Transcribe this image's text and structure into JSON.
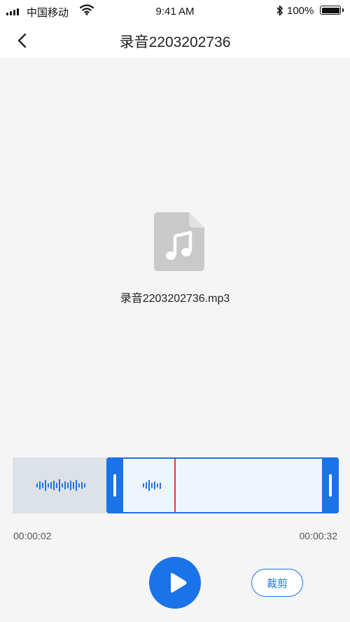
{
  "status_bar": {
    "carrier": "中国移动",
    "time": "9:41 AM",
    "battery": "100%",
    "icons": [
      "signal-icon",
      "wifi-icon",
      "bluetooth-icon",
      "battery-icon"
    ]
  },
  "nav": {
    "title": "录音2203202736",
    "back_icon": "chevron-left-icon"
  },
  "file": {
    "icon": "music-file-icon",
    "name": "录音2203202736.mp3"
  },
  "editor": {
    "start_time": "00:00:02",
    "end_time": "00:00:32",
    "play_icon": "play-icon",
    "trim_label": "裁剪"
  },
  "colors": {
    "accent": "#1a73e8",
    "playhead": "#e53935",
    "unselected_region": "#dde1e8",
    "selected_region": "#eff5fd",
    "background": "#f5f5f5"
  }
}
